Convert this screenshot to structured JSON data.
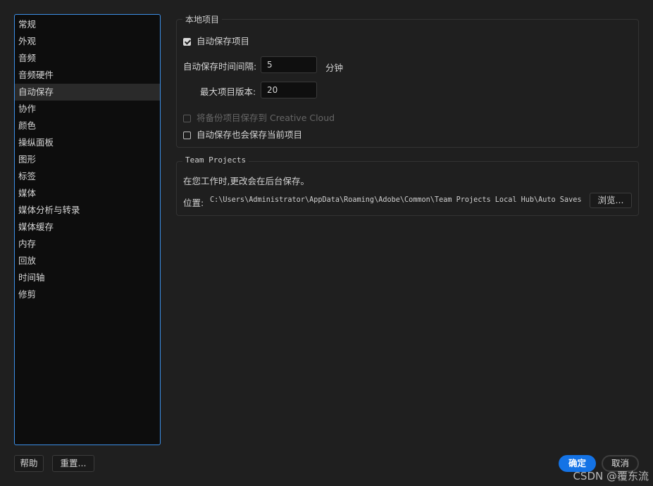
{
  "sidebar": {
    "items": [
      "常规",
      "外观",
      "音频",
      "音频硬件",
      "自动保存",
      "协作",
      "颜色",
      "操纵面板",
      "图形",
      "标签",
      "媒体",
      "媒体分析与转录",
      "媒体缓存",
      "内存",
      "回放",
      "时间轴",
      "修剪"
    ],
    "selected_index": 4
  },
  "local": {
    "legend": "本地项目",
    "autosave_label": "自动保存项目",
    "autosave_checked": true,
    "interval_label": "自动保存时间间隔:",
    "interval_value": "5",
    "interval_unit": "分钟",
    "max_versions_label": "最大项目版本:",
    "max_versions_value": "20",
    "backup_cc_label": "将备份项目保存到 Creative Cloud",
    "backup_cc_checked": false,
    "backup_cc_disabled": true,
    "save_current_label": "自动保存也会保存当前项目",
    "save_current_checked": false
  },
  "team": {
    "legend": "Team Projects",
    "info": "在您工作时,更改会在后台保存。",
    "location_label": "位置:",
    "location_path": "C:\\Users\\Administrator\\AppData\\Roaming\\Adobe\\Common\\Team Projects Local Hub\\Auto Saves",
    "browse_label": "浏览..."
  },
  "footer": {
    "help_label": "帮助",
    "reset_label": "重置...",
    "ok_label": "确定",
    "cancel_label": "取消"
  },
  "watermark": "CSDN @覆东流",
  "colors": {
    "accent": "#1473e6",
    "selection_border": "#3b8ee6",
    "background": "#1f1f1f"
  }
}
